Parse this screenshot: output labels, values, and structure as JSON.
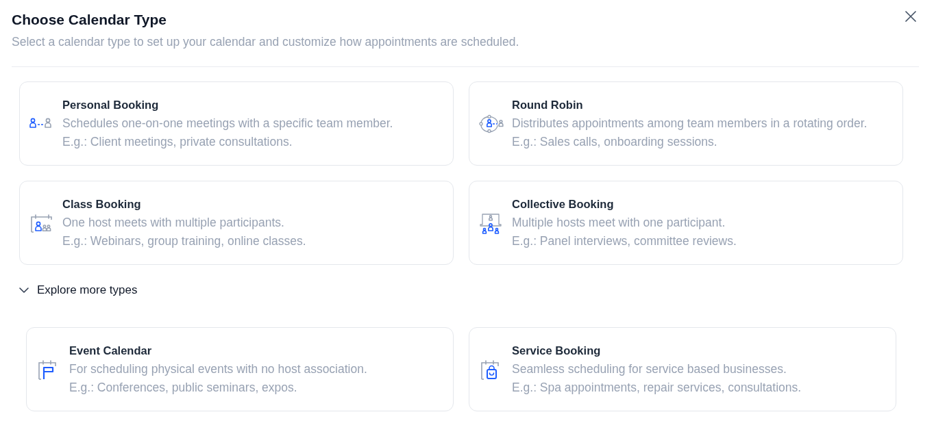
{
  "dialog": {
    "title": "Choose Calendar Type",
    "subtitle": "Select a calendar type to set up your calendar and customize how appointments are scheduled."
  },
  "calendar_types": [
    {
      "title": "Personal Booking",
      "description": "Schedules one-on-one meetings with a specific team member.",
      "example": "E.g.: Client meetings, private consultations."
    },
    {
      "title": "Round Robin",
      "description": "Distributes appointments among team members in a rotating order.",
      "example": "E.g.: Sales calls, onboarding sessions."
    },
    {
      "title": "Class Booking",
      "description": "One host meets with multiple participants.",
      "example": "E.g.: Webinars, group training, online classes."
    },
    {
      "title": "Collective Booking",
      "description": "Multiple hosts meet with one participant.",
      "example": "E.g.: Panel interviews, committee reviews."
    }
  ],
  "explore": {
    "label": "Explore more types",
    "expanded": true
  },
  "more_types": [
    {
      "title": "Event Calendar",
      "description": "For scheduling physical events with no host association.",
      "example": "E.g.: Conferences, public seminars, expos."
    },
    {
      "title": "Service Booking",
      "description": "Seamless scheduling for service based businesses.",
      "example": "E.g.: Spa appointments, repair services, consultations."
    }
  ]
}
